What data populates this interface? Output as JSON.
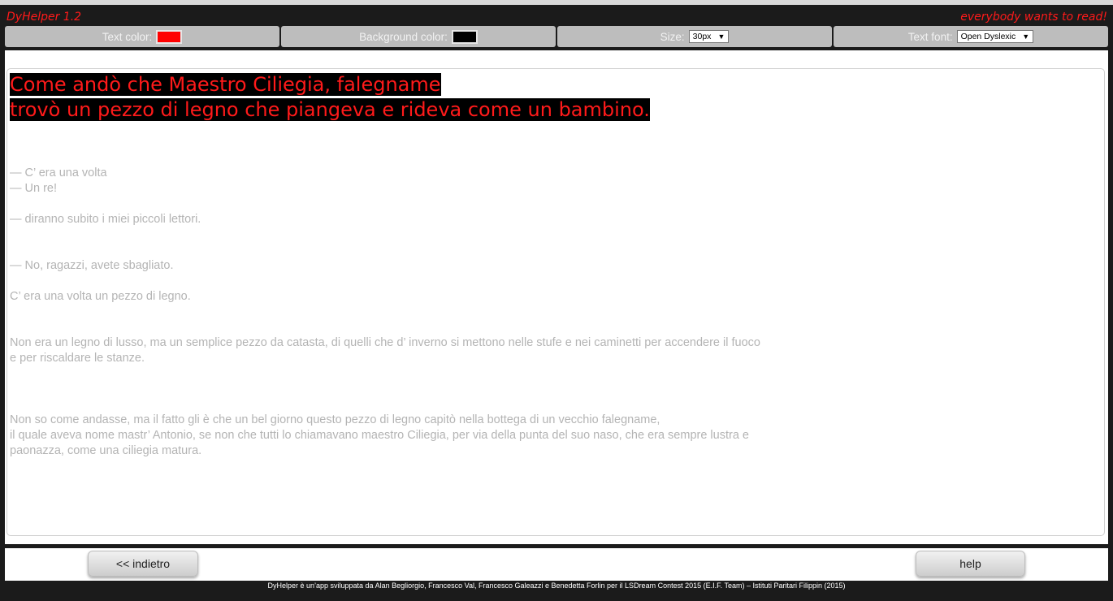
{
  "app": {
    "title": "DyHelper 1.2",
    "tagline": "everybody wants to read!"
  },
  "toolbar": {
    "text_color_label": "Text color:",
    "text_color_value": "#ff0000",
    "background_color_label": "Background color:",
    "background_color_value": "#000000",
    "size_label": "Size:",
    "size_value": "30px",
    "font_label": "Text font:",
    "font_value": "Open Dyslexic"
  },
  "reader": {
    "heading_line1": "Come andò che Maestro Ciliegia, falegname",
    "heading_line2": "trovò un pezzo di legno che piangeva e rideva come un bambino.",
    "lines": [
      "— C’ era una volta",
      "— Un re!",
      "— diranno subito i miei piccoli lettori.",
      "— No, ragazzi, avete sbagliato.",
      "C’ era una volta un pezzo di legno.",
      "Non era un legno di lusso, ma un semplice pezzo da catasta, di quelli che d’ inverno si mettono nelle stufe e nei caminetti per accendere il fuoco",
      "e per riscaldare le stanze.",
      "Non so come andasse, ma il fatto gli è che un bel giorno questo pezzo di legno capitò nella bottega di un vecchio falegname,",
      "il quale aveva nome mastr’ Antonio, se non che tutti lo chiamavano maestro Ciliegia, per via della punta del suo naso, che era sempre lustra e",
      "paonazza, come una ciliegia matura."
    ]
  },
  "nav": {
    "back_label": "<< indietro",
    "help_label": "help"
  },
  "footer": {
    "credits": "DyHelper è un’app sviluppata da Alan Begliorgio, Francesco Val, Francesco Galeazzi e Benedetta Forlin per il LSDream Contest 2015 (E.I.F. Team) – Istituti Paritari Filippin (2015)"
  }
}
